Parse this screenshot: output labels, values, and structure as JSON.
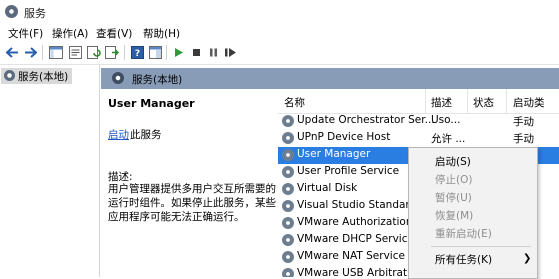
{
  "window": {
    "title": "服务"
  },
  "menu": [
    "文件(F)",
    "操作(A)",
    "查看(V)",
    "帮助(H)"
  ],
  "toolbar": {
    "buttons": [
      "back-icon",
      "forward-icon",
      "console-tree-icon",
      "properties-icon",
      "refresh-icon",
      "export-icon",
      "help-icon",
      "show-hide-icon",
      "play-icon",
      "stop-icon",
      "pause-icon",
      "restart-icon"
    ]
  },
  "tree": {
    "item": "服务(本地)"
  },
  "main": {
    "header": "服务(本地)",
    "service_name": "User Manager",
    "start_link": "启动",
    "start_suffix": "此服务",
    "desc_label": "描述:",
    "desc_text": "用户管理器提供多用户交互所需要的运行时组件。如果停止此服务，某些应用程序可能无法正确运行。"
  },
  "list": {
    "columns": [
      "名称",
      "描述",
      "状态",
      "启动类"
    ],
    "rows": [
      {
        "name": "Update Orchestrator Ser...",
        "desc": "Uso...",
        "start": "手动"
      },
      {
        "name": "UPnP Device Host",
        "desc": "允许 ...",
        "start": "手动"
      },
      {
        "name": "User Manager",
        "desc": "",
        "start": ""
      },
      {
        "name": "User Profile Service",
        "desc": "",
        "start": ""
      },
      {
        "name": "Virtual Disk",
        "desc": "",
        "start": ""
      },
      {
        "name": "Visual Studio Standard",
        "desc": "",
        "start": ""
      },
      {
        "name": "VMware Authorization",
        "desc": "",
        "start": ""
      },
      {
        "name": "VMware DHCP Service",
        "desc": "",
        "start": ""
      },
      {
        "name": "VMware NAT Service",
        "desc": "",
        "start": ""
      },
      {
        "name": "VMware USB Arbitratio",
        "desc": "",
        "start": ""
      }
    ],
    "selected_index": 2
  },
  "context_menu": {
    "items": [
      {
        "label": "启动(S)",
        "enabled": true
      },
      {
        "label": "停止(O)",
        "enabled": false
      },
      {
        "label": "暂停(U)",
        "enabled": false
      },
      {
        "label": "恢复(M)",
        "enabled": false
      },
      {
        "label": "重新启动(E)",
        "enabled": false
      },
      {
        "label": "所有任务(K)",
        "enabled": true
      }
    ],
    "submenu_arrow": "❯"
  },
  "colors": {
    "header": "#889cb7",
    "selection": "#2a7de1",
    "link": "#1c55c4"
  }
}
